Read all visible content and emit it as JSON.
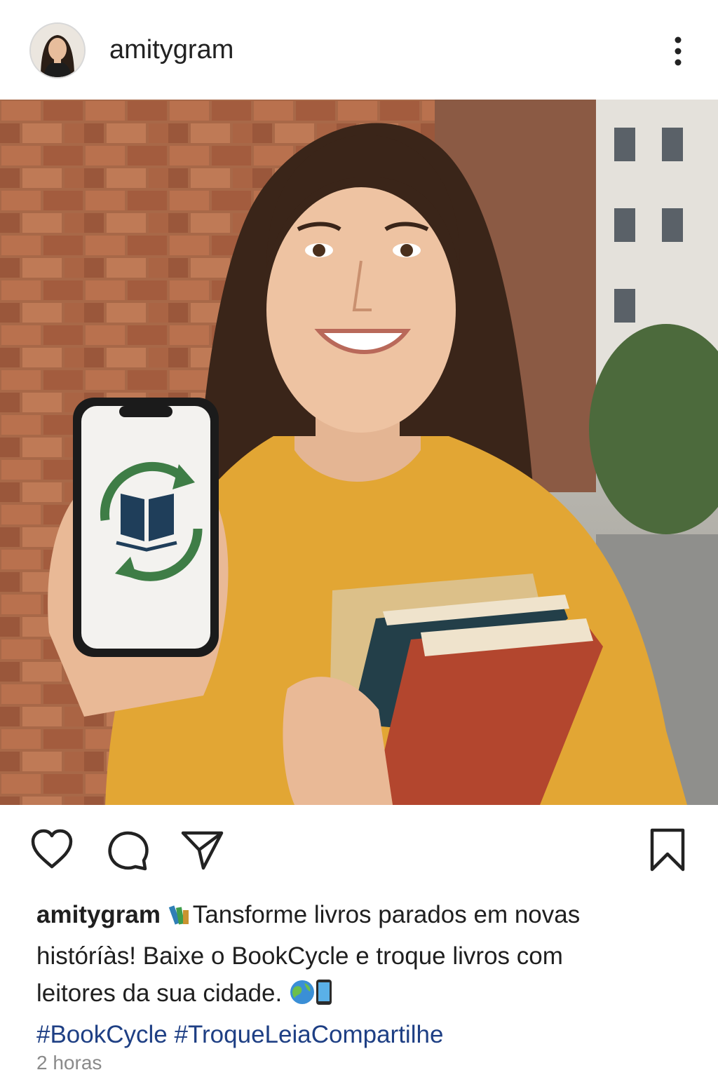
{
  "post": {
    "username": "amitygram",
    "more_icon": "more-vertical-icon",
    "image_alt": "Mulher sorrindo segurando um celular com o logo do BookCycle e uma pilha de livros",
    "actions": {
      "like_icon": "heart-icon",
      "comment_icon": "comment-icon",
      "share_icon": "send-icon",
      "save_icon": "bookmark-icon"
    },
    "caption": {
      "username": "amitygram",
      "text_line1": "Tansforme livros parados em novas",
      "text_line2": "históríàs! Baixe o BookCycle e troque livros com",
      "text_line3": "leitores da sua cidade.",
      "hashtags": "#BookCycle #TroqueLeiaCompartilhe"
    },
    "timestamp": "2 horas"
  },
  "colors": {
    "hashtag": "#1e3f84",
    "logo_green": "#3e7d46",
    "logo_navy": "#1f3e5a",
    "shirt": "#e2a634"
  }
}
